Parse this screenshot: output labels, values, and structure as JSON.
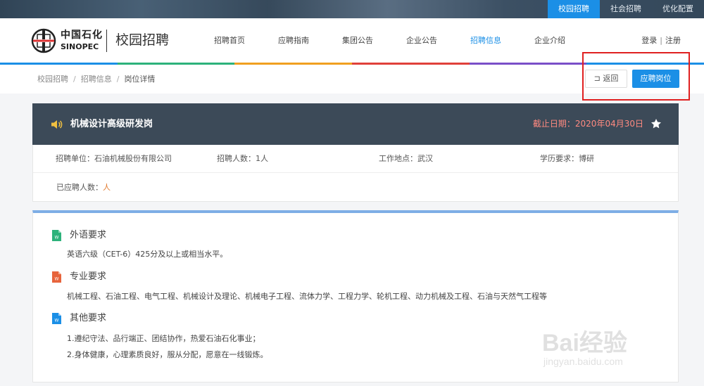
{
  "topbar": {
    "links": [
      "校园招聘",
      "社会招聘",
      "优化配置"
    ]
  },
  "header": {
    "brand_cn": "中国石化",
    "brand_en": "SINOPEC",
    "site_name": "校园招聘",
    "nav": [
      "招聘首页",
      "应聘指南",
      "集团公告",
      "企业公告",
      "招聘信息",
      "企业介绍"
    ],
    "login": "登录",
    "register": "注册"
  },
  "breadcrumb": {
    "items": [
      "校园招聘",
      "招聘信息",
      "岗位详情"
    ]
  },
  "actions": {
    "back": "返回",
    "apply": "应聘岗位"
  },
  "job": {
    "title": "机械设计高级研发岗",
    "deadline": "截止日期：2020年04月30日",
    "unit": "招聘单位：石油机械股份有限公司",
    "headcount": "招聘人数：1人",
    "location": "工作地点：武汉",
    "education": "学历要求：博研",
    "applied_label": "已应聘人数：",
    "applied_value": "人"
  },
  "requirements": [
    {
      "title": "外语要求",
      "lines": [
        "英语六级（CET-6）425分及以上或相当水平。"
      ]
    },
    {
      "title": "专业要求",
      "lines": [
        "机械工程、石油工程、电气工程、机械设计及理论、机械电子工程、流体力学、工程力学、轮机工程、动力机械及工程、石油与天然气工程等"
      ]
    },
    {
      "title": "其他要求",
      "lines": [
        "1.遵纪守法、品行端正、团结协作，热爱石油石化事业；",
        "2.身体健康，心理素质良好，服从分配，愿意在一线锻炼。"
      ]
    }
  ],
  "watermark": {
    "main": "Bai经验",
    "sub": "jingyan.baidu.com"
  },
  "colors": {
    "accent": "#1b8fe6",
    "job_header_bg": "#3c4a58",
    "deadline": "#ff8a80",
    "highlight_box": "#e02020",
    "line_colors": [
      "#1b8fe6",
      "#2db27b",
      "#f0a020",
      "#e0403a",
      "#7a4fc8",
      "#1b8fe6"
    ],
    "doc_icon_colors": [
      "#2db27b",
      "#e7643c",
      "#1b8fe6"
    ]
  }
}
